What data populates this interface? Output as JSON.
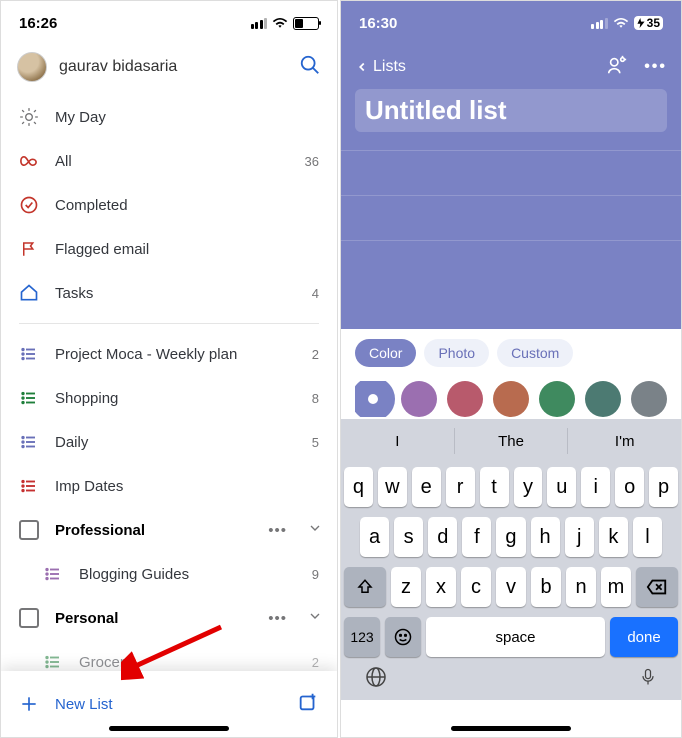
{
  "left": {
    "status_time": "16:26",
    "battery_pct": "31",
    "profile_name": "gaurav bidasaria",
    "smart_lists": [
      {
        "icon": "sun",
        "label": "My Day",
        "count": ""
      },
      {
        "icon": "infinity",
        "label": "All",
        "count": "36"
      },
      {
        "icon": "check-circle",
        "label": "Completed",
        "count": ""
      },
      {
        "icon": "flag",
        "label": "Flagged email",
        "count": ""
      },
      {
        "icon": "home-shield",
        "label": "Tasks",
        "count": "4"
      }
    ],
    "user_lists": [
      {
        "color": "blue",
        "label": "Project Moca - Weekly plan",
        "count": "2"
      },
      {
        "color": "green",
        "label": "Shopping",
        "count": "8"
      },
      {
        "color": "blue",
        "label": "Daily",
        "count": "5"
      },
      {
        "color": "red",
        "label": "Imp Dates",
        "count": ""
      }
    ],
    "folders": [
      {
        "name": "Professional",
        "items": [
          {
            "color": "purple",
            "label": "Blogging Guides",
            "count": "9"
          }
        ]
      },
      {
        "name": "Personal",
        "items": [
          {
            "color": "green",
            "label": "Grocery",
            "count": "2"
          }
        ]
      }
    ],
    "new_list_label": "New List"
  },
  "right": {
    "status_time": "16:30",
    "battery_pct": "35",
    "back_label": "Lists",
    "title_value": "Untitled list",
    "pills": {
      "color": "Color",
      "photo": "Photo",
      "custom": "Custom"
    },
    "swatches": [
      "#7a82c4",
      "#9b6fb0",
      "#b85a6c",
      "#b86b4f",
      "#3f8a5f",
      "#4c7a72",
      "#7a8288"
    ],
    "suggestions": [
      "I",
      "The",
      "I'm"
    ],
    "kb_row1": [
      "q",
      "w",
      "e",
      "r",
      "t",
      "y",
      "u",
      "i",
      "o",
      "p"
    ],
    "kb_row2": [
      "a",
      "s",
      "d",
      "f",
      "g",
      "h",
      "j",
      "k",
      "l"
    ],
    "kb_row3": [
      "z",
      "x",
      "c",
      "v",
      "b",
      "n",
      "m"
    ],
    "key_123": "123",
    "key_space": "space",
    "key_done": "done"
  }
}
